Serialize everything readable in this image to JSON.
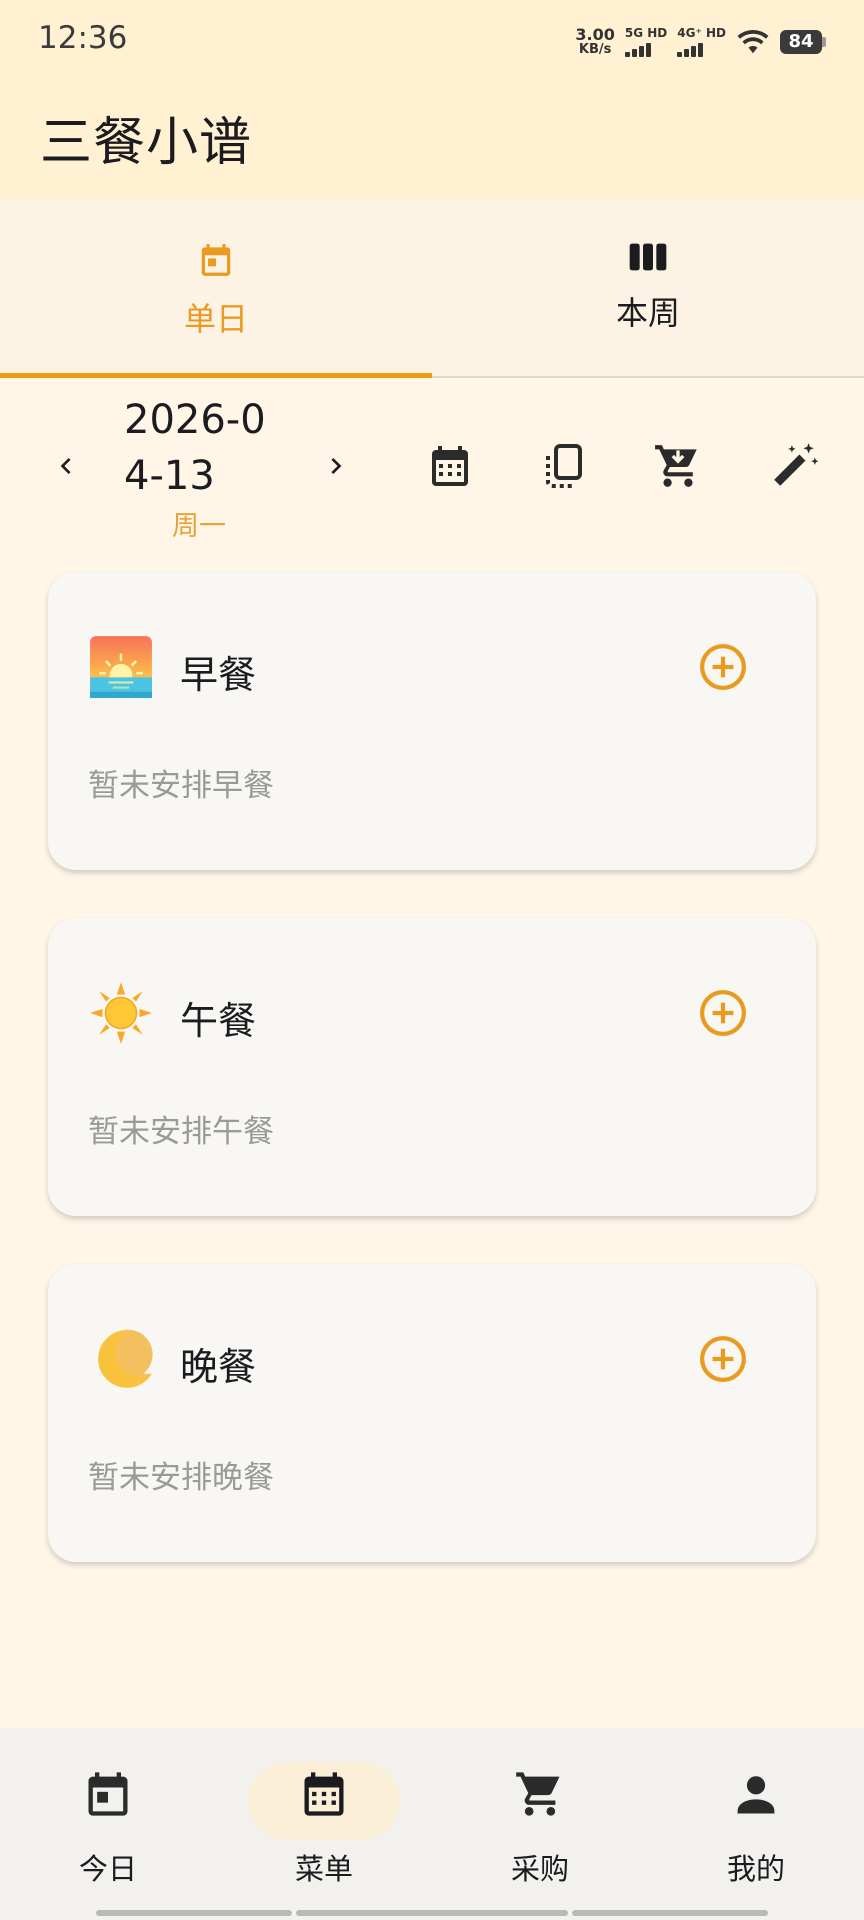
{
  "status_bar": {
    "time": "12:36",
    "net_speed_value": "3.00",
    "net_speed_unit": "KB/s",
    "sim1_label": "5G HD",
    "sim2_label": "4G⁺ HD",
    "battery": "84"
  },
  "app_bar": {
    "title": "三餐小谱"
  },
  "tabs": [
    {
      "label": "单日",
      "icon": "calendar-today-icon",
      "active": true
    },
    {
      "label": "本周",
      "icon": "view-week-icon",
      "active": false
    }
  ],
  "date_bar": {
    "date": "2026-04-13",
    "weekday": "周一",
    "tools": [
      "calendar-icon",
      "copy-icon",
      "add-to-cart-icon",
      "magic-wand-icon"
    ]
  },
  "meals": [
    {
      "emoji": "sunrise-icon",
      "title": "早餐",
      "empty_text": "暂未安排早餐"
    },
    {
      "emoji": "sun-icon",
      "title": "午餐",
      "empty_text": "暂未安排午餐"
    },
    {
      "emoji": "crescent-moon-icon",
      "title": "晚餐",
      "empty_text": "暂未安排晚餐"
    }
  ],
  "bottom_nav": [
    {
      "label": "今日",
      "icon": "today-icon",
      "active": false
    },
    {
      "label": "菜单",
      "icon": "calendar-month-icon",
      "active": true
    },
    {
      "label": "采购",
      "icon": "shopping-cart-icon",
      "active": false
    },
    {
      "label": "我的",
      "icon": "person-icon",
      "active": false
    }
  ],
  "colors": {
    "accent": "#ef9b15",
    "header_bg": "#fff1d2",
    "page_bg": "#fff6e8",
    "card_bg": "#f9f7f3",
    "muted_text": "#9a9a9a"
  }
}
